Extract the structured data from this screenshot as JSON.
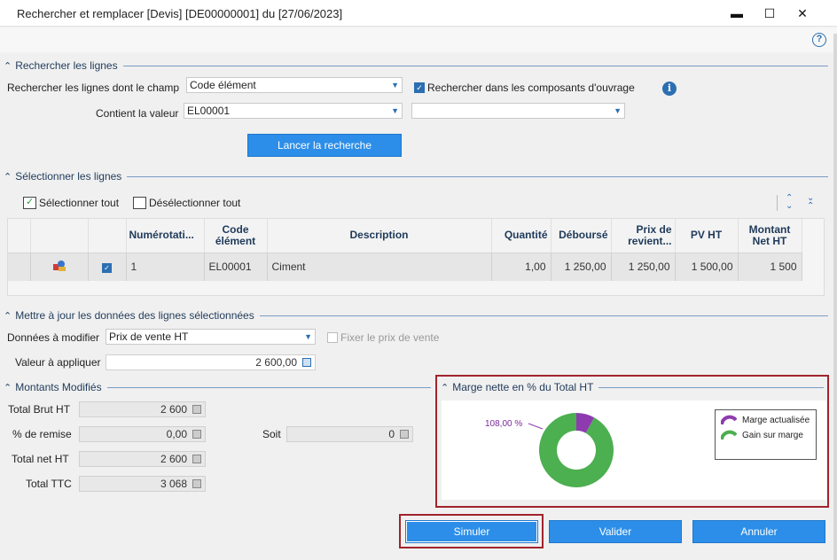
{
  "window": {
    "title": "Rechercher et remplacer [Devis] [DE00000001] du [27/06/2023]",
    "minimize": "▬",
    "maximize": "☐",
    "close": "✕",
    "help": "?"
  },
  "search": {
    "section_title": "Rechercher les lignes",
    "field_label": "Rechercher les lignes dont le champ",
    "field_value": "Code élément",
    "include_components_label": "Rechercher dans les composants d'ouvrage",
    "include_components_checked": true,
    "value_label": "Contient la valeur",
    "value": "EL00001",
    "value2": "",
    "launch_button": "Lancer la recherche"
  },
  "select": {
    "section_title": "Sélectionner les lignes",
    "select_all": "Sélectionner tout",
    "deselect_all": "Désélectionner tout",
    "columns": [
      "Numérotati...",
      "Code élément",
      "Description",
      "Quantité",
      "Déboursé",
      "Prix de revient...",
      "PV HT",
      "Montant Net HT"
    ],
    "rows": [
      {
        "checked": true,
        "numerotation": "1",
        "code": "EL00001",
        "description": "Ciment",
        "quantite": "1,00",
        "debourse": "1 250,00",
        "prix_revient": "1 250,00",
        "pv_ht": "1 500,00",
        "montant_net": "1 500"
      }
    ]
  },
  "update": {
    "section_title": "Mettre à jour les données des lignes sélectionnées",
    "data_label": "Données à modifier",
    "data_value": "Prix de vente HT",
    "fix_price_label": "Fixer le prix de vente",
    "apply_label": "Valeur à appliquer",
    "apply_value": "2 600,00"
  },
  "amounts": {
    "section_title": "Montants Modifiés",
    "total_brut_label": "Total Brut HT",
    "total_brut": "2 600",
    "remise_label": "% de remise",
    "remise": "0,00",
    "soit_label": "Soit",
    "soit": "0",
    "total_net_label": "Total net HT",
    "total_net": "2 600",
    "total_ttc_label": "Total TTC",
    "total_ttc": "3 068"
  },
  "chart_data": {
    "type": "pie",
    "title": "Marge nette en % du Total HT",
    "slice_label": "108,00 %",
    "series": [
      {
        "name": "Marge actualisée",
        "value": 8,
        "color": "#8e3bb0"
      },
      {
        "name": "Gain sur marge",
        "value": 92,
        "color": "#4caf50"
      }
    ],
    "legend_position": "right"
  },
  "buttons": {
    "simuler": "Simuler",
    "valider": "Valider",
    "annuler": "Annuler"
  }
}
